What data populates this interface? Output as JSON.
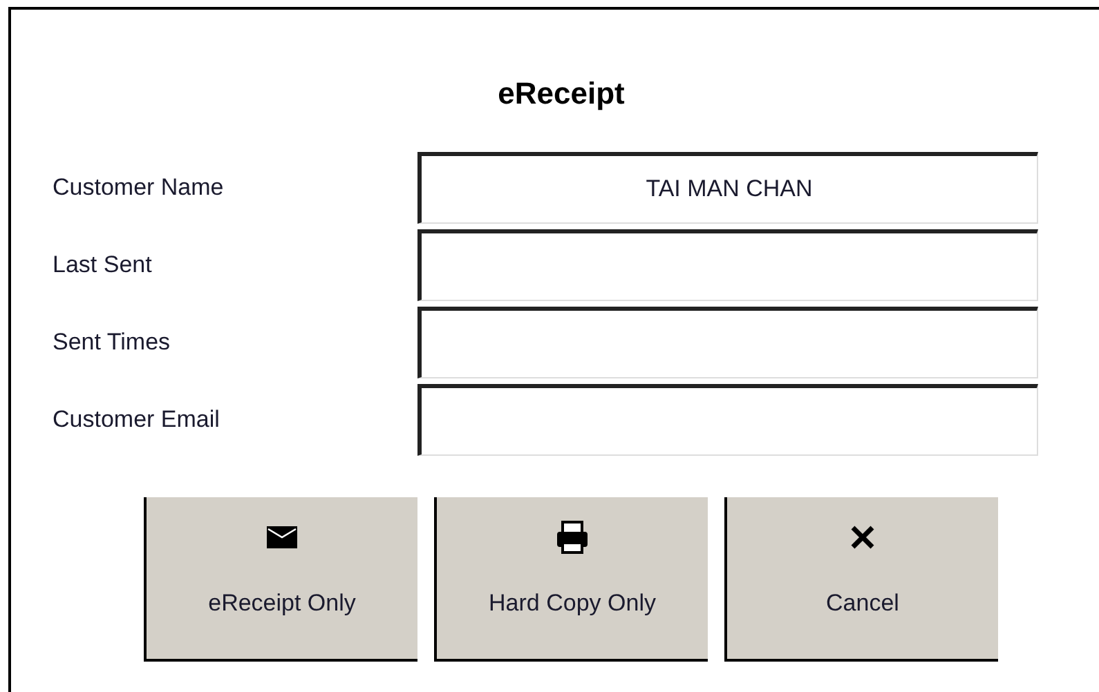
{
  "dialog": {
    "title": "eReceipt"
  },
  "fields": [
    {
      "label": "Customer Name",
      "value": "TAI MAN CHAN"
    },
    {
      "label": "Last Sent"
    },
    {
      "label": "Sent Times"
    },
    {
      "label": "Customer Email"
    }
  ],
  "buttons": [
    {
      "label": "eReceipt Only",
      "kind": "email"
    },
    {
      "label": "Hard Copy Only",
      "kind": "print"
    },
    {
      "label": "Cancel",
      "kind": "cancel"
    }
  ]
}
